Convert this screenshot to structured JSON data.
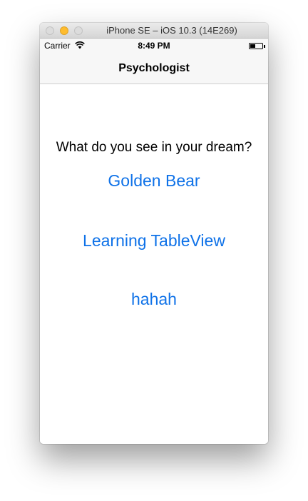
{
  "window": {
    "title": "iPhone SE – iOS 10.3 (14E269)"
  },
  "status_bar": {
    "carrier": "Carrier",
    "time": "8:49 PM",
    "icons": [
      "wifi-icon",
      "battery-icon"
    ]
  },
  "nav_bar": {
    "title": "Psychologist"
  },
  "content": {
    "question": "What do you see in your dream?",
    "buttons": [
      {
        "label": "Golden Bear"
      },
      {
        "label": "Learning TableView"
      },
      {
        "label": "hahah"
      }
    ]
  },
  "colors": {
    "tint": "#0f72e8",
    "bar_background": "#f7f7f7",
    "minimize_button": "#febc2e"
  }
}
